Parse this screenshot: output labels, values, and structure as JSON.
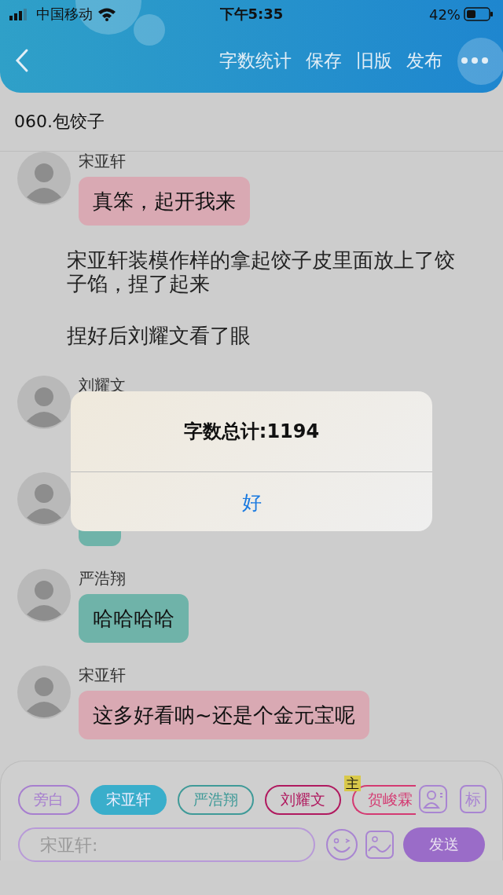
{
  "status_bar": {
    "carrier": "中国移动",
    "time": "下午5:35",
    "battery": "42%"
  },
  "header": {
    "actions": [
      "字数统计",
      "保存",
      "旧版",
      "发布"
    ]
  },
  "title": "060.包饺子",
  "messages": [
    {
      "kind": "chat",
      "name": "宋亚轩",
      "text": "真笨，起开我来",
      "color": "#d9a9b3"
    },
    {
      "kind": "narration",
      "text": "宋亚轩装模作样的拿起饺子皮里面放上了饺子馅，捏了起来"
    },
    {
      "kind": "narration",
      "text": "捏好后刘耀文看了眼"
    },
    {
      "kind": "chat",
      "name": "刘耀文"
    },
    {
      "kind": "chat",
      "color": "#6fb3a9"
    },
    {
      "kind": "chat",
      "name": "严浩翔",
      "text": "哈哈哈哈",
      "color": "#6fb3a9"
    },
    {
      "kind": "chat",
      "name": "宋亚轩",
      "text": "这多好看呐~还是个金元宝呢",
      "color": "#d9a9b3"
    }
  ],
  "composer": {
    "roles": [
      {
        "label": "旁白",
        "color": "#a77fcf",
        "selected": false
      },
      {
        "label": "宋亚轩",
        "color": "#3aaecb",
        "selected": true
      },
      {
        "label": "严浩翔",
        "color": "#3f9a98",
        "selected": false
      },
      {
        "label": "刘耀文",
        "color": "#b0195f",
        "selected": false
      },
      {
        "label": "贺峻霖",
        "color": "#d43a72",
        "selected": false,
        "badge": "主"
      }
    ],
    "tag_button": "标",
    "placeholder": "宋亚轩:",
    "send": "发送"
  },
  "dialog": {
    "message": "字数总计:1194",
    "button": "好"
  }
}
